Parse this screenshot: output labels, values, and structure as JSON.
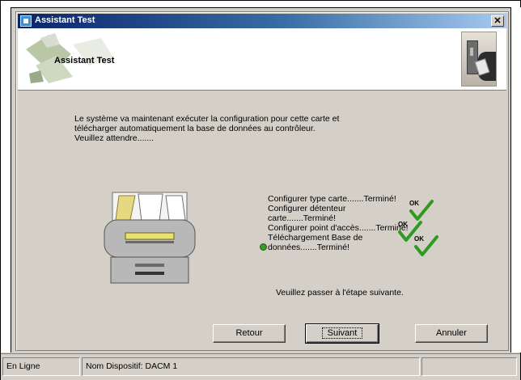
{
  "window": {
    "title": "Assistant Test",
    "close_glyph": "✕"
  },
  "header": {
    "title": "Assistant Test",
    "art_icon": "wizard-banner-art",
    "photo_icon": "card-reader-photo"
  },
  "main": {
    "intro": "Le système va maintenant exécuter la configuration pour cette carte et télécharger automatiquement la base de données au contrôleur. Veuillez attendre.......",
    "steps": [
      {
        "label": "Configurer type carte.......Terminé!"
      },
      {
        "label": "Configurer détenteur"
      },
      {
        "label": "carte.......Terminé!"
      },
      {
        "label": "Configurer point d'accès.......Terminé!"
      },
      {
        "label": "Téléchargement Base de"
      },
      {
        "label": "données.......Terminé!",
        "bullet": true
      }
    ],
    "hint": "Veuillez passer à l'étape suivante.",
    "ok_badges": [
      {
        "text": "OK",
        "color": "#2e9a22"
      },
      {
        "text": "OK",
        "color": "#2e9a22"
      },
      {
        "text": "OK",
        "color": "#2e9a22"
      }
    ]
  },
  "buttons": {
    "back": "Retour",
    "next": "Suivant",
    "cancel": "Annuler"
  },
  "statusbar": {
    "status": "En Ligne",
    "device": "Nom Dispositif: DACM 1",
    "extra": ""
  }
}
